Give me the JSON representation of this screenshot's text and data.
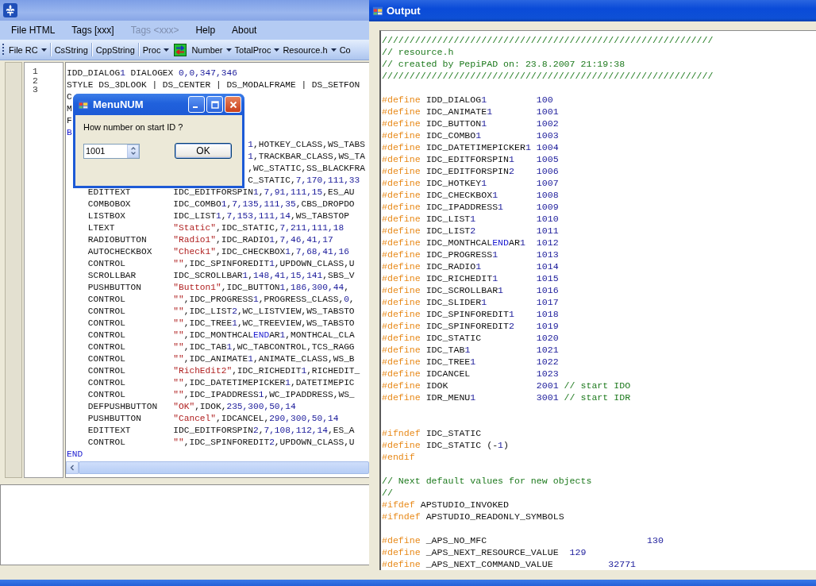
{
  "main_window": {
    "menu": [
      {
        "label": "File HTML",
        "disabled": false
      },
      {
        "label": "Tags [xxx]",
        "disabled": false
      },
      {
        "label": "Tags <xxx>",
        "disabled": true
      },
      {
        "label": "Help",
        "disabled": false
      },
      {
        "label": "About",
        "disabled": false
      }
    ],
    "toolbar": [
      {
        "kind": "dropdown",
        "label": "File RC"
      },
      {
        "kind": "separator"
      },
      {
        "kind": "button",
        "label": "CsString"
      },
      {
        "kind": "separator"
      },
      {
        "kind": "button",
        "label": "CppString"
      },
      {
        "kind": "separator"
      },
      {
        "kind": "dropdown",
        "label": "Proc"
      },
      {
        "kind": "icon"
      },
      {
        "kind": "dropdown",
        "label": "Number"
      },
      {
        "kind": "dropdown",
        "label": "TotalProc"
      },
      {
        "kind": "dropdown",
        "label": "Resource.h"
      },
      {
        "kind": "button",
        "label": "Co"
      }
    ],
    "editor": {
      "line_numbers": [
        "1",
        "2",
        "3"
      ],
      "lines": [
        {
          "kind": "code",
          "segments": [
            {
              "text": "IDD_DIALOG",
              "kind": "plain"
            },
            {
              "text": "1",
              "kind": "number"
            },
            {
              "text": " DIALOGEX ",
              "kind": "plain"
            },
            {
              "text": "0,0,347,346",
              "kind": "number"
            }
          ]
        },
        {
          "kind": "code",
          "segments": [
            {
              "text": "STYLE DS_3DLOOK | DS_CENTER | DS_MODALFRAME | DS_SETFON",
              "kind": "plain"
            }
          ]
        },
        {
          "kind": "code",
          "segments": [
            {
              "text": "C",
              "kind": "plain"
            }
          ]
        },
        {
          "kind": "code",
          "segments": [
            {
              "text": "M",
              "kind": "plain"
            }
          ]
        },
        {
          "kind": "code",
          "segments": [
            {
              "text": "F",
              "kind": "plain"
            }
          ]
        },
        {
          "kind": "code",
          "segments": [
            {
              "text": "B",
              "kind": "keyword"
            }
          ]
        },
        {
          "kind": "code",
          "segments": [
            {
              "text": "                                  1",
              "kind": "number"
            },
            {
              "text": ",HOTKEY_CLASS,WS_TABS",
              "kind": "plain"
            }
          ]
        },
        {
          "kind": "code",
          "segments": [
            {
              "text": "                                  1",
              "kind": "number"
            },
            {
              "text": ",TRACKBAR_CLASS,WS_TA",
              "kind": "plain"
            }
          ]
        },
        {
          "kind": "code",
          "segments": [
            {
              "text": "                                  ,WC_STATIC,SS_BLACKFRA",
              "kind": "plain"
            }
          ]
        },
        {
          "kind": "code",
          "segments": [
            {
              "text": "                                  C_STATIC,",
              "kind": "plain"
            },
            {
              "text": "7,170,111,33",
              "kind": "number"
            }
          ]
        },
        {
          "kind": "code",
          "segments": [
            {
              "text": "    EDITTEXT        IDC_EDITFORSPIN",
              "kind": "plain"
            },
            {
              "text": "1",
              "kind": "number"
            },
            {
              "text": ",",
              "kind": "plain"
            },
            {
              "text": "7,91,111,15",
              "kind": "number"
            },
            {
              "text": ",ES_AU",
              "kind": "plain"
            }
          ]
        },
        {
          "kind": "code",
          "segments": [
            {
              "text": "    COMBOBOX        IDC_COMBO",
              "kind": "plain"
            },
            {
              "text": "1",
              "kind": "number"
            },
            {
              "text": ",",
              "kind": "plain"
            },
            {
              "text": "7,135,111,35",
              "kind": "number"
            },
            {
              "text": ",CBS_DROPDO",
              "kind": "plain"
            }
          ]
        },
        {
          "kind": "code",
          "segments": [
            {
              "text": "    LISTBOX         IDC_LIST",
              "kind": "plain"
            },
            {
              "text": "1",
              "kind": "number"
            },
            {
              "text": ",",
              "kind": "plain"
            },
            {
              "text": "7,153,111,14",
              "kind": "number"
            },
            {
              "text": ",WS_TABSTOP",
              "kind": "plain"
            }
          ]
        },
        {
          "kind": "code",
          "segments": [
            {
              "text": "    LTEXT           ",
              "kind": "plain"
            },
            {
              "text": "\"Static\"",
              "kind": "string"
            },
            {
              "text": ",IDC_STATIC,",
              "kind": "plain"
            },
            {
              "text": "7,211,111,18",
              "kind": "number"
            }
          ]
        },
        {
          "kind": "code",
          "segments": [
            {
              "text": "    RADIOBUTTON     ",
              "kind": "plain"
            },
            {
              "text": "\"Radio1\"",
              "kind": "string"
            },
            {
              "text": ",IDC_RADIO",
              "kind": "plain"
            },
            {
              "text": "1",
              "kind": "number"
            },
            {
              "text": ",",
              "kind": "plain"
            },
            {
              "text": "7,46,41,17",
              "kind": "number"
            }
          ]
        },
        {
          "kind": "code",
          "segments": [
            {
              "text": "    AUTOCHECKBOX    ",
              "kind": "plain"
            },
            {
              "text": "\"Check1\"",
              "kind": "string"
            },
            {
              "text": ",IDC_CHECKBOX",
              "kind": "plain"
            },
            {
              "text": "1",
              "kind": "number"
            },
            {
              "text": ",",
              "kind": "plain"
            },
            {
              "text": "7,68,41,16",
              "kind": "number"
            }
          ]
        },
        {
          "kind": "code",
          "segments": [
            {
              "text": "    CONTROL         ",
              "kind": "plain"
            },
            {
              "text": "\"\"",
              "kind": "string"
            },
            {
              "text": ",IDC_SPINFOREDIT",
              "kind": "plain"
            },
            {
              "text": "1",
              "kind": "number"
            },
            {
              "text": ",UPDOWN_CLASS,U",
              "kind": "plain"
            }
          ]
        },
        {
          "kind": "code",
          "segments": [
            {
              "text": "    SCROLLBAR       IDC_SCROLLBAR",
              "kind": "plain"
            },
            {
              "text": "1",
              "kind": "number"
            },
            {
              "text": ",",
              "kind": "plain"
            },
            {
              "text": "148,41,15,141",
              "kind": "number"
            },
            {
              "text": ",SBS_V",
              "kind": "plain"
            }
          ]
        },
        {
          "kind": "code",
          "segments": [
            {
              "text": "    PUSHBUTTON      ",
              "kind": "plain"
            },
            {
              "text": "\"Button1\"",
              "kind": "string"
            },
            {
              "text": ",IDC_BUTTON",
              "kind": "plain"
            },
            {
              "text": "1",
              "kind": "number"
            },
            {
              "text": ",",
              "kind": "plain"
            },
            {
              "text": "186,300,44",
              "kind": "number"
            },
            {
              "text": ",",
              "kind": "plain"
            }
          ]
        },
        {
          "kind": "code",
          "segments": [
            {
              "text": "    CONTROL         ",
              "kind": "plain"
            },
            {
              "text": "\"\"",
              "kind": "string"
            },
            {
              "text": ",IDC_PROGRESS",
              "kind": "plain"
            },
            {
              "text": "1",
              "kind": "number"
            },
            {
              "text": ",PROGRESS_CLASS,",
              "kind": "plain"
            },
            {
              "text": "0",
              "kind": "number"
            },
            {
              "text": ",",
              "kind": "plain"
            }
          ]
        },
        {
          "kind": "code",
          "segments": [
            {
              "text": "    CONTROL         ",
              "kind": "plain"
            },
            {
              "text": "\"\"",
              "kind": "string"
            },
            {
              "text": ",IDC_LIST",
              "kind": "plain"
            },
            {
              "text": "2",
              "kind": "number"
            },
            {
              "text": ",WC_LISTVIEW,WS_TABSTO",
              "kind": "plain"
            }
          ]
        },
        {
          "kind": "code",
          "segments": [
            {
              "text": "    CONTROL         ",
              "kind": "plain"
            },
            {
              "text": "\"\"",
              "kind": "string"
            },
            {
              "text": ",IDC_TREE",
              "kind": "plain"
            },
            {
              "text": "1",
              "kind": "number"
            },
            {
              "text": ",WC_TREEVIEW,WS_TABSTO",
              "kind": "plain"
            }
          ]
        },
        {
          "kind": "code",
          "segments": [
            {
              "text": "    CONTROL         ",
              "kind": "plain"
            },
            {
              "text": "\"\"",
              "kind": "string"
            },
            {
              "text": ",IDC_MONTHCAL",
              "kind": "plain"
            },
            {
              "text": "END",
              "kind": "keyword"
            },
            {
              "text": "AR",
              "kind": "plain"
            },
            {
              "text": "1",
              "kind": "number"
            },
            {
              "text": ",MONTHCAL_CLA",
              "kind": "plain"
            }
          ]
        },
        {
          "kind": "code",
          "segments": [
            {
              "text": "    CONTROL         ",
              "kind": "plain"
            },
            {
              "text": "\"\"",
              "kind": "string"
            },
            {
              "text": ",IDC_TAB",
              "kind": "plain"
            },
            {
              "text": "1",
              "kind": "number"
            },
            {
              "text": ",WC_TABCONTROL,TCS_RAGG",
              "kind": "plain"
            }
          ]
        },
        {
          "kind": "code",
          "segments": [
            {
              "text": "    CONTROL         ",
              "kind": "plain"
            },
            {
              "text": "\"\"",
              "kind": "string"
            },
            {
              "text": ",IDC_ANIMATE",
              "kind": "plain"
            },
            {
              "text": "1",
              "kind": "number"
            },
            {
              "text": ",ANIMATE_CLASS,WS_B",
              "kind": "plain"
            }
          ]
        },
        {
          "kind": "code",
          "segments": [
            {
              "text": "    CONTROL         ",
              "kind": "plain"
            },
            {
              "text": "\"RichEdit2\"",
              "kind": "string"
            },
            {
              "text": ",IDC_RICHEDIT",
              "kind": "plain"
            },
            {
              "text": "1",
              "kind": "number"
            },
            {
              "text": ",RICHEDIT_",
              "kind": "plain"
            }
          ]
        },
        {
          "kind": "code",
          "segments": [
            {
              "text": "    CONTROL         ",
              "kind": "plain"
            },
            {
              "text": "\"\"",
              "kind": "string"
            },
            {
              "text": ",IDC_DATETIMEPICKER",
              "kind": "plain"
            },
            {
              "text": "1",
              "kind": "number"
            },
            {
              "text": ",DATETIMEPIC",
              "kind": "plain"
            }
          ]
        },
        {
          "kind": "code",
          "segments": [
            {
              "text": "    CONTROL         ",
              "kind": "plain"
            },
            {
              "text": "\"\"",
              "kind": "string"
            },
            {
              "text": ",IDC_IPADDRESS",
              "kind": "plain"
            },
            {
              "text": "1",
              "kind": "number"
            },
            {
              "text": ",WC_IPADDRESS,WS_",
              "kind": "plain"
            }
          ]
        },
        {
          "kind": "code",
          "segments": [
            {
              "text": "    DEFPUSHBUTTON   ",
              "kind": "plain"
            },
            {
              "text": "\"OK\"",
              "kind": "string"
            },
            {
              "text": ",IDOK,",
              "kind": "plain"
            },
            {
              "text": "235,300,50,14",
              "kind": "number"
            }
          ]
        },
        {
          "kind": "code",
          "segments": [
            {
              "text": "    PUSHBUTTON      ",
              "kind": "plain"
            },
            {
              "text": "\"Cancel\"",
              "kind": "string"
            },
            {
              "text": ",IDCANCEL,",
              "kind": "plain"
            },
            {
              "text": "290,300,50,14",
              "kind": "number"
            }
          ]
        },
        {
          "kind": "code",
          "segments": [
            {
              "text": "    EDITTEXT        IDC_EDITFORSPIN",
              "kind": "plain"
            },
            {
              "text": "2",
              "kind": "number"
            },
            {
              "text": ",",
              "kind": "plain"
            },
            {
              "text": "7,108,112,14",
              "kind": "number"
            },
            {
              "text": ",ES_A",
              "kind": "plain"
            }
          ]
        },
        {
          "kind": "code",
          "segments": [
            {
              "text": "    CONTROL         ",
              "kind": "plain"
            },
            {
              "text": "\"\"",
              "kind": "string"
            },
            {
              "text": ",IDC_SPINFOREDIT",
              "kind": "plain"
            },
            {
              "text": "2",
              "kind": "number"
            },
            {
              "text": ",UPDOWN_CLASS,U",
              "kind": "plain"
            }
          ]
        },
        {
          "kind": "code",
          "segments": [
            {
              "text": "END",
              "kind": "keyword"
            }
          ]
        }
      ]
    }
  },
  "dialog": {
    "title": "MenuNUM",
    "prompt": "How number on start ID ?",
    "value": "1001",
    "ok_button": "OK"
  },
  "output_window": {
    "title": "Output",
    "lines": [
      {
        "kind": "code",
        "segments": [
          {
            "text": "////////////////////////////////////////////////////////////",
            "kind": "comment"
          }
        ]
      },
      {
        "kind": "code",
        "segments": [
          {
            "text": "// resource.h",
            "kind": "comment"
          }
        ]
      },
      {
        "kind": "code",
        "segments": [
          {
            "text": "// created by PepiPAD on: 23.8.2007 21:19:38",
            "kind": "comment"
          }
        ]
      },
      {
        "kind": "code",
        "segments": [
          {
            "text": "////////////////////////////////////////////////////////////",
            "kind": "comment"
          }
        ]
      },
      {
        "kind": "blank"
      },
      {
        "kind": "code",
        "segments": [
          {
            "text": "#define",
            "kind": "directive"
          },
          {
            "text": " IDD_DIALOG",
            "kind": "plain"
          },
          {
            "text": "1         100",
            "kind": "number"
          }
        ]
      },
      {
        "kind": "code",
        "segments": [
          {
            "text": "#define",
            "kind": "directive"
          },
          {
            "text": " IDC_ANIMATE",
            "kind": "plain"
          },
          {
            "text": "1        1001",
            "kind": "number"
          }
        ]
      },
      {
        "kind": "code",
        "segments": [
          {
            "text": "#define",
            "kind": "directive"
          },
          {
            "text": " IDC_BUTTON",
            "kind": "plain"
          },
          {
            "text": "1         1002",
            "kind": "number"
          }
        ]
      },
      {
        "kind": "code",
        "segments": [
          {
            "text": "#define",
            "kind": "directive"
          },
          {
            "text": " IDC_COMBO",
            "kind": "plain"
          },
          {
            "text": "1          1003",
            "kind": "number"
          }
        ]
      },
      {
        "kind": "code",
        "segments": [
          {
            "text": "#define",
            "kind": "directive"
          },
          {
            "text": " IDC_DATETIMEPICKER",
            "kind": "plain"
          },
          {
            "text": "1 1004",
            "kind": "number"
          }
        ]
      },
      {
        "kind": "code",
        "segments": [
          {
            "text": "#define",
            "kind": "directive"
          },
          {
            "text": " IDC_EDITFORSPIN",
            "kind": "plain"
          },
          {
            "text": "1    1005",
            "kind": "number"
          }
        ]
      },
      {
        "kind": "code",
        "segments": [
          {
            "text": "#define",
            "kind": "directive"
          },
          {
            "text": " IDC_EDITFORSPIN",
            "kind": "plain"
          },
          {
            "text": "2    1006",
            "kind": "number"
          }
        ]
      },
      {
        "kind": "code",
        "segments": [
          {
            "text": "#define",
            "kind": "directive"
          },
          {
            "text": " IDC_HOTKEY",
            "kind": "plain"
          },
          {
            "text": "1         1007",
            "kind": "number"
          }
        ]
      },
      {
        "kind": "code",
        "segments": [
          {
            "text": "#define",
            "kind": "directive"
          },
          {
            "text": " IDC_CHECKBOX",
            "kind": "plain"
          },
          {
            "text": "1       1008",
            "kind": "number"
          }
        ]
      },
      {
        "kind": "code",
        "segments": [
          {
            "text": "#define",
            "kind": "directive"
          },
          {
            "text": " IDC_IPADDRESS",
            "kind": "plain"
          },
          {
            "text": "1      1009",
            "kind": "number"
          }
        ]
      },
      {
        "kind": "code",
        "segments": [
          {
            "text": "#define",
            "kind": "directive"
          },
          {
            "text": " IDC_LIST",
            "kind": "plain"
          },
          {
            "text": "1           1010",
            "kind": "number"
          }
        ]
      },
      {
        "kind": "code",
        "segments": [
          {
            "text": "#define",
            "kind": "directive"
          },
          {
            "text": " IDC_LIST",
            "kind": "plain"
          },
          {
            "text": "2           1011",
            "kind": "number"
          }
        ]
      },
      {
        "kind": "code",
        "segments": [
          {
            "text": "#define",
            "kind": "directive"
          },
          {
            "text": " IDC_MONTHCAL",
            "kind": "plain"
          },
          {
            "text": "END",
            "kind": "keyword"
          },
          {
            "text": "AR",
            "kind": "plain"
          },
          {
            "text": "1  1012",
            "kind": "number"
          }
        ]
      },
      {
        "kind": "code",
        "segments": [
          {
            "text": "#define",
            "kind": "directive"
          },
          {
            "text": " IDC_PROGRESS",
            "kind": "plain"
          },
          {
            "text": "1       1013",
            "kind": "number"
          }
        ]
      },
      {
        "kind": "code",
        "segments": [
          {
            "text": "#define",
            "kind": "directive"
          },
          {
            "text": " IDC_RADIO",
            "kind": "plain"
          },
          {
            "text": "1          1014",
            "kind": "number"
          }
        ]
      },
      {
        "kind": "code",
        "segments": [
          {
            "text": "#define",
            "kind": "directive"
          },
          {
            "text": " IDC_RICHEDIT",
            "kind": "plain"
          },
          {
            "text": "1       1015",
            "kind": "number"
          }
        ]
      },
      {
        "kind": "code",
        "segments": [
          {
            "text": "#define",
            "kind": "directive"
          },
          {
            "text": " IDC_SCROLLBAR",
            "kind": "plain"
          },
          {
            "text": "1      1016",
            "kind": "number"
          }
        ]
      },
      {
        "kind": "code",
        "segments": [
          {
            "text": "#define",
            "kind": "directive"
          },
          {
            "text": " IDC_SLIDER",
            "kind": "plain"
          },
          {
            "text": "1         1017",
            "kind": "number"
          }
        ]
      },
      {
        "kind": "code",
        "segments": [
          {
            "text": "#define",
            "kind": "directive"
          },
          {
            "text": " IDC_SPINFOREDIT",
            "kind": "plain"
          },
          {
            "text": "1    1018",
            "kind": "number"
          }
        ]
      },
      {
        "kind": "code",
        "segments": [
          {
            "text": "#define",
            "kind": "directive"
          },
          {
            "text": " IDC_SPINFOREDIT",
            "kind": "plain"
          },
          {
            "text": "2    1019",
            "kind": "number"
          }
        ]
      },
      {
        "kind": "code",
        "segments": [
          {
            "text": "#define",
            "kind": "directive"
          },
          {
            "text": " IDC_STATIC",
            "kind": "plain"
          },
          {
            "text": "          1020",
            "kind": "number"
          }
        ]
      },
      {
        "kind": "code",
        "segments": [
          {
            "text": "#define",
            "kind": "directive"
          },
          {
            "text": " IDC_TAB",
            "kind": "plain"
          },
          {
            "text": "1            1021",
            "kind": "number"
          }
        ]
      },
      {
        "kind": "code",
        "segments": [
          {
            "text": "#define",
            "kind": "directive"
          },
          {
            "text": " IDC_TREE",
            "kind": "plain"
          },
          {
            "text": "1           1022",
            "kind": "number"
          }
        ]
      },
      {
        "kind": "code",
        "segments": [
          {
            "text": "#define",
            "kind": "directive"
          },
          {
            "text": " IDCANCEL",
            "kind": "plain"
          },
          {
            "text": "            1023",
            "kind": "number"
          }
        ]
      },
      {
        "kind": "code",
        "segments": [
          {
            "text": "#define",
            "kind": "directive"
          },
          {
            "text": " IDOK",
            "kind": "plain"
          },
          {
            "text": "                2001",
            "kind": "number"
          },
          {
            "text": " // start IDO",
            "kind": "comment"
          }
        ]
      },
      {
        "kind": "code",
        "segments": [
          {
            "text": "#define",
            "kind": "directive"
          },
          {
            "text": " IDR_MENU",
            "kind": "plain"
          },
          {
            "text": "1           3001",
            "kind": "number"
          },
          {
            "text": " // start IDR",
            "kind": "comment"
          }
        ]
      },
      {
        "kind": "blank"
      },
      {
        "kind": "blank"
      },
      {
        "kind": "code",
        "segments": [
          {
            "text": "#ifndef",
            "kind": "directive"
          },
          {
            "text": " IDC_STATIC",
            "kind": "plain"
          }
        ]
      },
      {
        "kind": "code",
        "segments": [
          {
            "text": "#define",
            "kind": "directive"
          },
          {
            "text": " IDC_STATIC (-",
            "kind": "plain"
          },
          {
            "text": "1",
            "kind": "number"
          },
          {
            "text": ")",
            "kind": "plain"
          }
        ]
      },
      {
        "kind": "code",
        "segments": [
          {
            "text": "#endif",
            "kind": "directive"
          }
        ]
      },
      {
        "kind": "blank"
      },
      {
        "kind": "code",
        "segments": [
          {
            "text": "// Next default values for new objects",
            "kind": "comment"
          }
        ]
      },
      {
        "kind": "code",
        "segments": [
          {
            "text": "//",
            "kind": "comment"
          }
        ]
      },
      {
        "kind": "code",
        "segments": [
          {
            "text": "#ifdef",
            "kind": "directive"
          },
          {
            "text": " APSTUDIO_INVOKED",
            "kind": "plain"
          }
        ]
      },
      {
        "kind": "code",
        "segments": [
          {
            "text": "#ifndef",
            "kind": "directive"
          },
          {
            "text": " APSTUDIO_READONLY_SYMBOLS",
            "kind": "plain"
          }
        ]
      },
      {
        "kind": "blank"
      },
      {
        "kind": "code",
        "segments": [
          {
            "text": "#define",
            "kind": "directive"
          },
          {
            "text": " _APS_NO_MFC",
            "kind": "plain"
          },
          {
            "text": "                             130",
            "kind": "number"
          }
        ]
      },
      {
        "kind": "code",
        "segments": [
          {
            "text": "#define",
            "kind": "directive"
          },
          {
            "text": " _APS_NEXT_RESOURCE_VALUE",
            "kind": "plain"
          },
          {
            "text": "  129",
            "kind": "number"
          }
        ]
      },
      {
        "kind": "code",
        "segments": [
          {
            "text": "#define",
            "kind": "directive"
          },
          {
            "text": " _APS_NEXT_COMMAND_VALUE",
            "kind": "plain"
          },
          {
            "text": "          32771",
            "kind": "number"
          }
        ]
      }
    ]
  }
}
